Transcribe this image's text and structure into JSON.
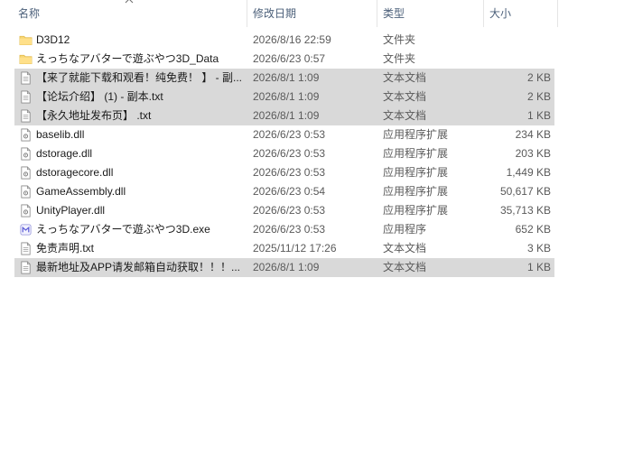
{
  "columns": {
    "name": "名称",
    "date": "修改日期",
    "type": "类型",
    "size": "大小"
  },
  "files": [
    {
      "name": "D3D12",
      "date": "2026/8/16 22:59",
      "type": "文件夹",
      "size": "",
      "icon": "folder-icon",
      "selected": false
    },
    {
      "name": "えっちなアバターで遊ぶやつ3D_Data",
      "date": "2026/6/23 0:57",
      "type": "文件夹",
      "size": "",
      "icon": "folder-icon",
      "selected": false
    },
    {
      "name": "【来了就能下载和观看！纯免费！ 】 - 副...",
      "date": "2026/8/1 1:09",
      "type": "文本文档",
      "size": "2 KB",
      "icon": "text-file-icon",
      "selected": true
    },
    {
      "name": "【论坛介绍】 (1) - 副本.txt",
      "date": "2026/8/1 1:09",
      "type": "文本文档",
      "size": "2 KB",
      "icon": "text-file-icon",
      "selected": true
    },
    {
      "name": "【永久地址发布页】 .txt",
      "date": "2026/8/1 1:09",
      "type": "文本文档",
      "size": "1 KB",
      "icon": "text-file-icon",
      "selected": true
    },
    {
      "name": "baselib.dll",
      "date": "2026/6/23 0:53",
      "type": "应用程序扩展",
      "size": "234 KB",
      "icon": "dll-file-icon",
      "selected": false
    },
    {
      "name": "dstorage.dll",
      "date": "2026/6/23 0:53",
      "type": "应用程序扩展",
      "size": "203 KB",
      "icon": "dll-file-icon",
      "selected": false
    },
    {
      "name": "dstoragecore.dll",
      "date": "2026/6/23 0:53",
      "type": "应用程序扩展",
      "size": "1,449 KB",
      "icon": "dll-file-icon",
      "selected": false
    },
    {
      "name": "GameAssembly.dll",
      "date": "2026/6/23 0:54",
      "type": "应用程序扩展",
      "size": "50,617 KB",
      "icon": "dll-file-icon",
      "selected": false
    },
    {
      "name": "UnityPlayer.dll",
      "date": "2026/6/23 0:53",
      "type": "应用程序扩展",
      "size": "35,713 KB",
      "icon": "dll-file-icon",
      "selected": false
    },
    {
      "name": "えっちなアバターで遊ぶやつ3D.exe",
      "date": "2026/6/23 0:53",
      "type": "应用程序",
      "size": "652 KB",
      "icon": "exe-file-icon",
      "selected": false
    },
    {
      "name": "免责声明.txt",
      "date": "2025/11/12 17:26",
      "type": "文本文档",
      "size": "3 KB",
      "icon": "text-file-icon",
      "selected": false
    },
    {
      "name": "最新地址及APP请发邮箱自动获取！！！...",
      "date": "2026/8/1 1:09",
      "type": "文本文档",
      "size": "1 KB",
      "icon": "text-file-icon",
      "selected": true
    }
  ],
  "colors": {
    "selection": "#d9d9d9",
    "folder": "#f8d775",
    "header_text": "#4c607a"
  }
}
